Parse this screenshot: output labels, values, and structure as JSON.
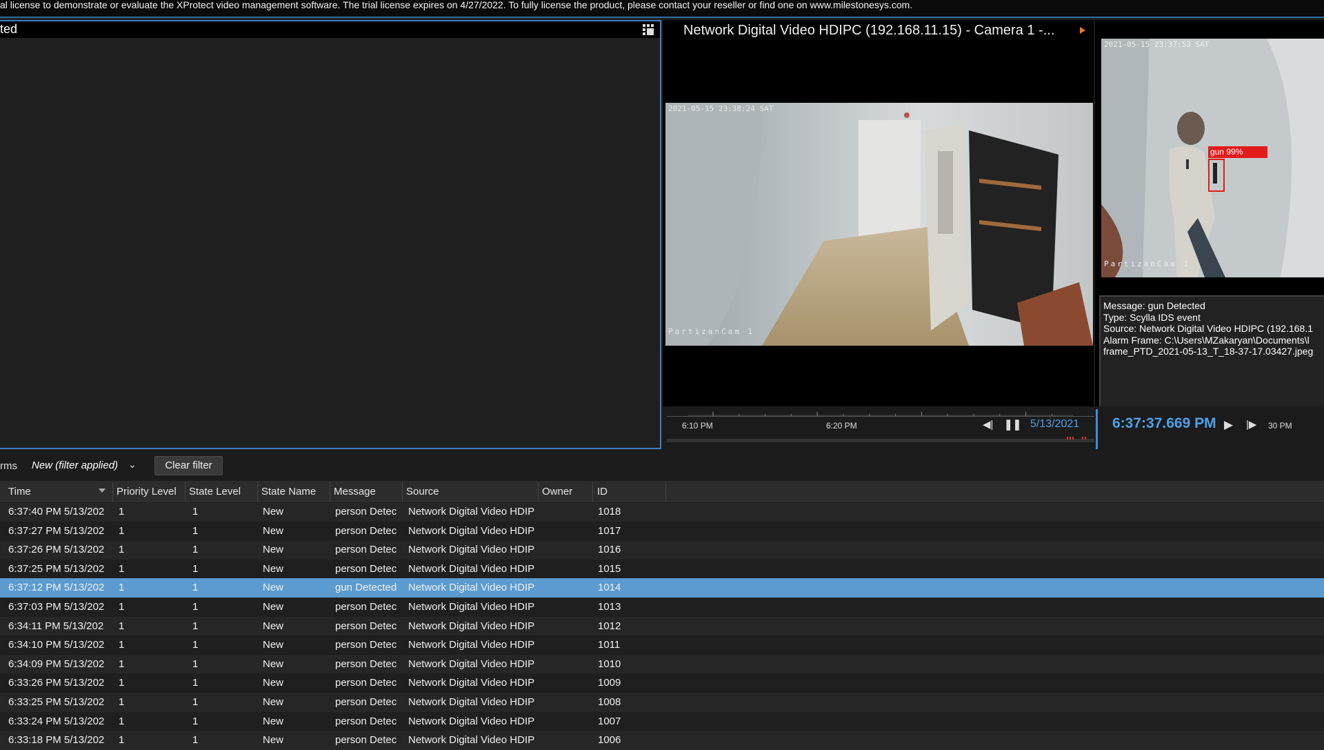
{
  "banner": {
    "text": "al license to demonstrate or evaluate the XProtect video management software. The trial license expires on 4/27/2022. To fully license the product, please contact your reseller or find one on www.milestonesys.com."
  },
  "left_panel": {
    "title": "ted"
  },
  "camera": {
    "title": "Network Digital Video HDIPC (192.168.11.15) - Camera 1 -...",
    "timestamp": "2021-05-15 23:38:24 SAT",
    "overlay_name": "PartizanCam 1"
  },
  "alarm_preview": {
    "timestamp": "2021-05-15 23:37:53 SAT",
    "overlay_name": "PartizanCam 1",
    "detection_label": "gun 99%",
    "info_lines": [
      "Message: gun Detected",
      "Type: Scylla IDS event",
      "Source: Network Digital Video HDIPC (192.168.1",
      "Alarm Frame: C:\\Users\\MZakaryan\\Documents\\l",
      "frame_PTD_2021-05-13_T_18-37-17.03427.jpeg"
    ]
  },
  "timeline": {
    "labels": [
      "6:10 PM",
      "6:20 PM",
      "30 PM"
    ],
    "date": "5/13/2021",
    "time": "6:37:37.669 PM"
  },
  "toolbar": {
    "label": "rms",
    "filter": "New (filter applied)",
    "clear_label": "Clear filter"
  },
  "table": {
    "columns": [
      "Time",
      "Priority Level",
      "State Level",
      "State Name",
      "Message",
      "Source",
      "Owner",
      "ID"
    ],
    "rows": [
      {
        "time": "6:37:40 PM 5/13/202",
        "priority": "1",
        "state_level": "1",
        "state_name": "New",
        "message": "person Detec",
        "source": "Network Digital Video HDIP",
        "owner": "",
        "id": "1018"
      },
      {
        "time": "6:37:27 PM 5/13/202",
        "priority": "1",
        "state_level": "1",
        "state_name": "New",
        "message": "person Detec",
        "source": "Network Digital Video HDIP",
        "owner": "",
        "id": "1017"
      },
      {
        "time": "6:37:26 PM 5/13/202",
        "priority": "1",
        "state_level": "1",
        "state_name": "New",
        "message": "person Detec",
        "source": "Network Digital Video HDIP",
        "owner": "",
        "id": "1016"
      },
      {
        "time": "6:37:25 PM 5/13/202",
        "priority": "1",
        "state_level": "1",
        "state_name": "New",
        "message": "person Detec",
        "source": "Network Digital Video HDIP",
        "owner": "",
        "id": "1015"
      },
      {
        "time": "6:37:12 PM 5/13/202",
        "priority": "1",
        "state_level": "1",
        "state_name": "New",
        "message": "gun Detected",
        "source": "Network Digital Video HDIP",
        "owner": "",
        "id": "1014",
        "selected": true
      },
      {
        "time": "6:37:03 PM 5/13/202",
        "priority": "1",
        "state_level": "1",
        "state_name": "New",
        "message": "person Detec",
        "source": "Network Digital Video HDIP",
        "owner": "",
        "id": "1013"
      },
      {
        "time": "6:34:11 PM 5/13/202",
        "priority": "1",
        "state_level": "1",
        "state_name": "New",
        "message": "person Detec",
        "source": "Network Digital Video HDIP",
        "owner": "",
        "id": "1012"
      },
      {
        "time": "6:34:10 PM 5/13/202",
        "priority": "1",
        "state_level": "1",
        "state_name": "New",
        "message": "person Detec",
        "source": "Network Digital Video HDIP",
        "owner": "",
        "id": "1011"
      },
      {
        "time": "6:34:09 PM 5/13/202",
        "priority": "1",
        "state_level": "1",
        "state_name": "New",
        "message": "person Detec",
        "source": "Network Digital Video HDIP",
        "owner": "",
        "id": "1010"
      },
      {
        "time": "6:33:26 PM 5/13/202",
        "priority": "1",
        "state_level": "1",
        "state_name": "New",
        "message": "person Detec",
        "source": "Network Digital Video HDIP",
        "owner": "",
        "id": "1009"
      },
      {
        "time": "6:33:25 PM 5/13/202",
        "priority": "1",
        "state_level": "1",
        "state_name": "New",
        "message": "person Detec",
        "source": "Network Digital Video HDIP",
        "owner": "",
        "id": "1008"
      },
      {
        "time": "6:33:24 PM 5/13/202",
        "priority": "1",
        "state_level": "1",
        "state_name": "New",
        "message": "person Detec",
        "source": "Network Digital Video HDIP",
        "owner": "",
        "id": "1007"
      },
      {
        "time": "6:33:18 PM 5/13/202",
        "priority": "1",
        "state_level": "1",
        "state_name": "New",
        "message": "person Detec",
        "source": "Network Digital Video HDIP",
        "owner": "",
        "id": "1006"
      }
    ]
  },
  "colors": {
    "accent": "#3d90d9",
    "selected_row": "#5b9bd0",
    "detection_box": "#e21b1b",
    "alert_arrow": "#f07a1a"
  }
}
